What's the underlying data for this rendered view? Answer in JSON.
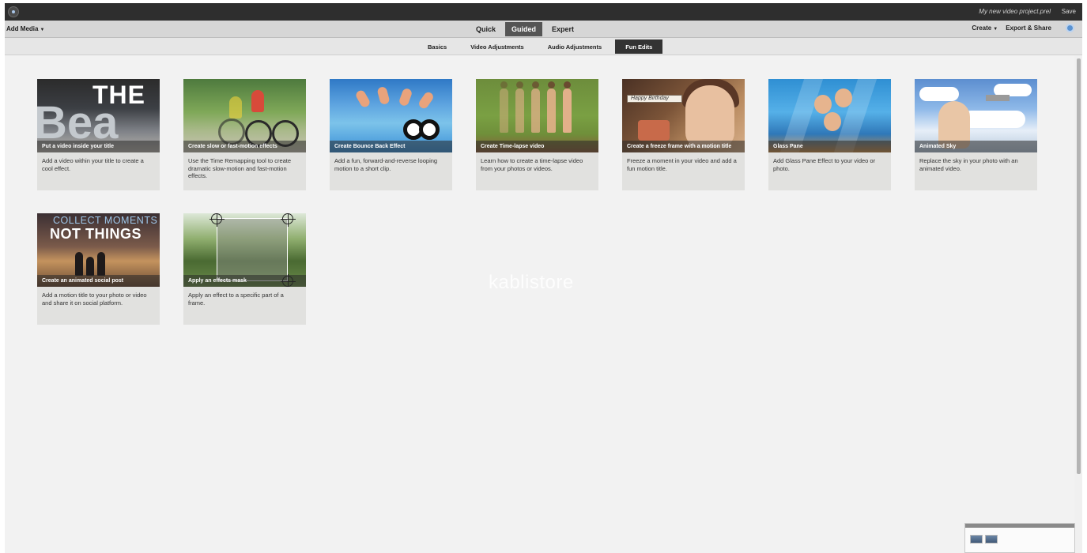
{
  "titlebar": {
    "project_name": "My new video project.prel",
    "save_label": "Save"
  },
  "modebar": {
    "add_media_label": "Add Media",
    "modes": [
      {
        "label": "Quick",
        "active": false
      },
      {
        "label": "Guided",
        "active": true
      },
      {
        "label": "Expert",
        "active": false
      }
    ],
    "create_label": "Create",
    "export_label": "Export & Share"
  },
  "subtabs": [
    {
      "label": "Basics",
      "active": false
    },
    {
      "label": "Video Adjustments",
      "active": false
    },
    {
      "label": "Audio Adjustments",
      "active": false
    },
    {
      "label": "Fun Edits",
      "active": true
    }
  ],
  "cards": [
    {
      "title": "Put a video inside your title",
      "description": "Add a video within your title to create a cool effect.",
      "thumb_text_1": "THE",
      "thumb_text_2": "Bea"
    },
    {
      "title": "Create slow or fast-motion effects",
      "description": "Use the Time Remapping tool to create dramatic slow-motion and fast-motion effects."
    },
    {
      "title": "Create Bounce Back Effect",
      "description": "Add a fun, forward-and-reverse looping motion to a short clip."
    },
    {
      "title": "Create Time-lapse video",
      "description": "Learn how to create a time-lapse video from your photos or videos."
    },
    {
      "title": "Create a freeze frame with a motion title",
      "description": "Freeze a moment in your video and add a fun motion title.",
      "thumb_text_1": "Happy Birthday"
    },
    {
      "title": "Glass Pane",
      "description": "Add Glass Pane Effect to your video or photo."
    },
    {
      "title": "Animated Sky",
      "description": "Replace the sky in your photo with an animated video."
    },
    {
      "title": "Create an animated social post",
      "description": "Add a motion title to your photo or video and share it on social platform.",
      "thumb_text_1": "COLLECT MOMENTS",
      "thumb_text_2": "NOT THINGS"
    },
    {
      "title": "Apply an effects mask",
      "description": "Apply an effect to a specific part of a frame."
    }
  ],
  "watermark": "kablistore",
  "icons": {
    "app_logo": "app-logo-icon",
    "help": "help-icon",
    "dropdown": "caret-down-icon"
  },
  "colors": {
    "titlebar_bg": "#2e2e2e",
    "active_mode_bg": "#555555",
    "active_subtab_bg": "#333333",
    "card_bg": "#e1e1df",
    "content_bg": "#f2f2f2"
  }
}
